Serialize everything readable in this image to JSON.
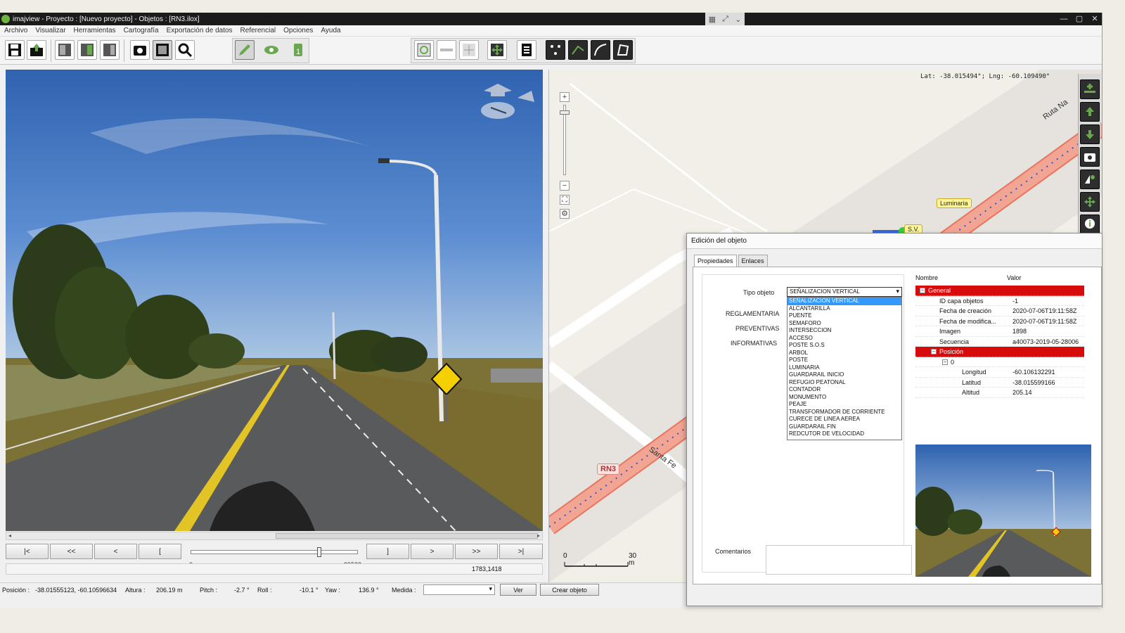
{
  "window": {
    "title": "imajview - Proyecto : [Nuevo proyecto] - Objetos : [RN3.ilox]",
    "controls": [
      "—",
      "▢",
      "✕"
    ]
  },
  "menu": [
    "Archivo",
    "Visualizar",
    "Herramientas",
    "Cartografía",
    "Exportación de datos",
    "Referencial",
    "Opciones",
    "Ayuda"
  ],
  "navigation": {
    "buttons": [
      "|<",
      "<<",
      "<",
      "[",
      "]",
      ">",
      ">>",
      ">|"
    ],
    "slider_min": "0",
    "slider_max": "39583",
    "slider_fraction": 0.78,
    "image_coords": "1783,1418"
  },
  "status": {
    "posicion_label": "Posición :",
    "posicion_value": "-38.01555123, -60.10596634",
    "altura_label": "Altura :",
    "altura_value": "206.19 m",
    "pitch_label": "Pitch :",
    "pitch_value": "-2.7 °",
    "roll_label": "Roll :",
    "roll_value": "-10.1 °",
    "yaw_label": "Yaw :",
    "yaw_value": "136.9 °",
    "medida_label": "Medida :",
    "ver_button": "Ver",
    "crear_button": "Crear objeto"
  },
  "map": {
    "coords": "Lat: -38.015494°; Lng: -60.109490°",
    "labels": {
      "ruta": "Ruta Na",
      "luminaria": "Luminaria",
      "sv": "S.V.",
      "rn3": "RN3",
      "santa_fe": "Santa Fe"
    },
    "scale_start": "0",
    "scale_end": "30",
    "scale_unit": "m"
  },
  "dialog": {
    "title": "Edición del objeto",
    "tabs": [
      "Propiedades",
      "Enlaces"
    ],
    "tipo_label": "Tipo objeto",
    "tipo_selected": "SEÑALIZACION VERTICAL",
    "side_labels": [
      "REGLAMENTARIA",
      "PREVENTIVAS",
      "INFORMATIVAS"
    ],
    "options": [
      "SEÑALIZACION VERTICAL",
      "ALCANTARILLA",
      "PUENTE",
      "SEMAFORO",
      "INTERSECCION",
      "ACCESO",
      "POSTE S.O.S",
      "ARBOL",
      "POSTE",
      "LUMINARIA",
      "GUARDARAIL INICIO",
      "REFUGIO PEATONAL",
      "CONTADOR",
      "MONUMENTO",
      "PEAJE",
      "TRANSFORMADOR DE CORRIENTE",
      "CURECE DE LINEA AEREA",
      "GUARDARAIL FIN",
      "REDCUTOR DE VELOCIDAD"
    ],
    "comentarios_label": "Comentarios",
    "table_headers": [
      "Nombre",
      "Valor"
    ],
    "general_label": "General",
    "general_rows": [
      {
        "k": "ID capa objetos",
        "v": "-1"
      },
      {
        "k": "Fecha de creación",
        "v": "2020-07-06T19:11:58Z"
      },
      {
        "k": "Fecha de modifica...",
        "v": "2020-07-06T19:11:58Z"
      },
      {
        "k": "Imagen",
        "v": "1898"
      },
      {
        "k": "Secuencia",
        "v": "a40073-2019-05-28006"
      }
    ],
    "posicion_label": "Posición",
    "posicion_index": "0",
    "posicion_rows": [
      {
        "k": "Longitud",
        "v": "-60.106132291"
      },
      {
        "k": "Latitud",
        "v": "-38.015599166"
      },
      {
        "k": "Altitud",
        "v": "205.14"
      }
    ]
  },
  "colors": {
    "accent_red": "#d60b0b",
    "route_fill": "#f0a08c",
    "selection_blue": "#3399ff",
    "sign_yellow": "#f5d000"
  }
}
